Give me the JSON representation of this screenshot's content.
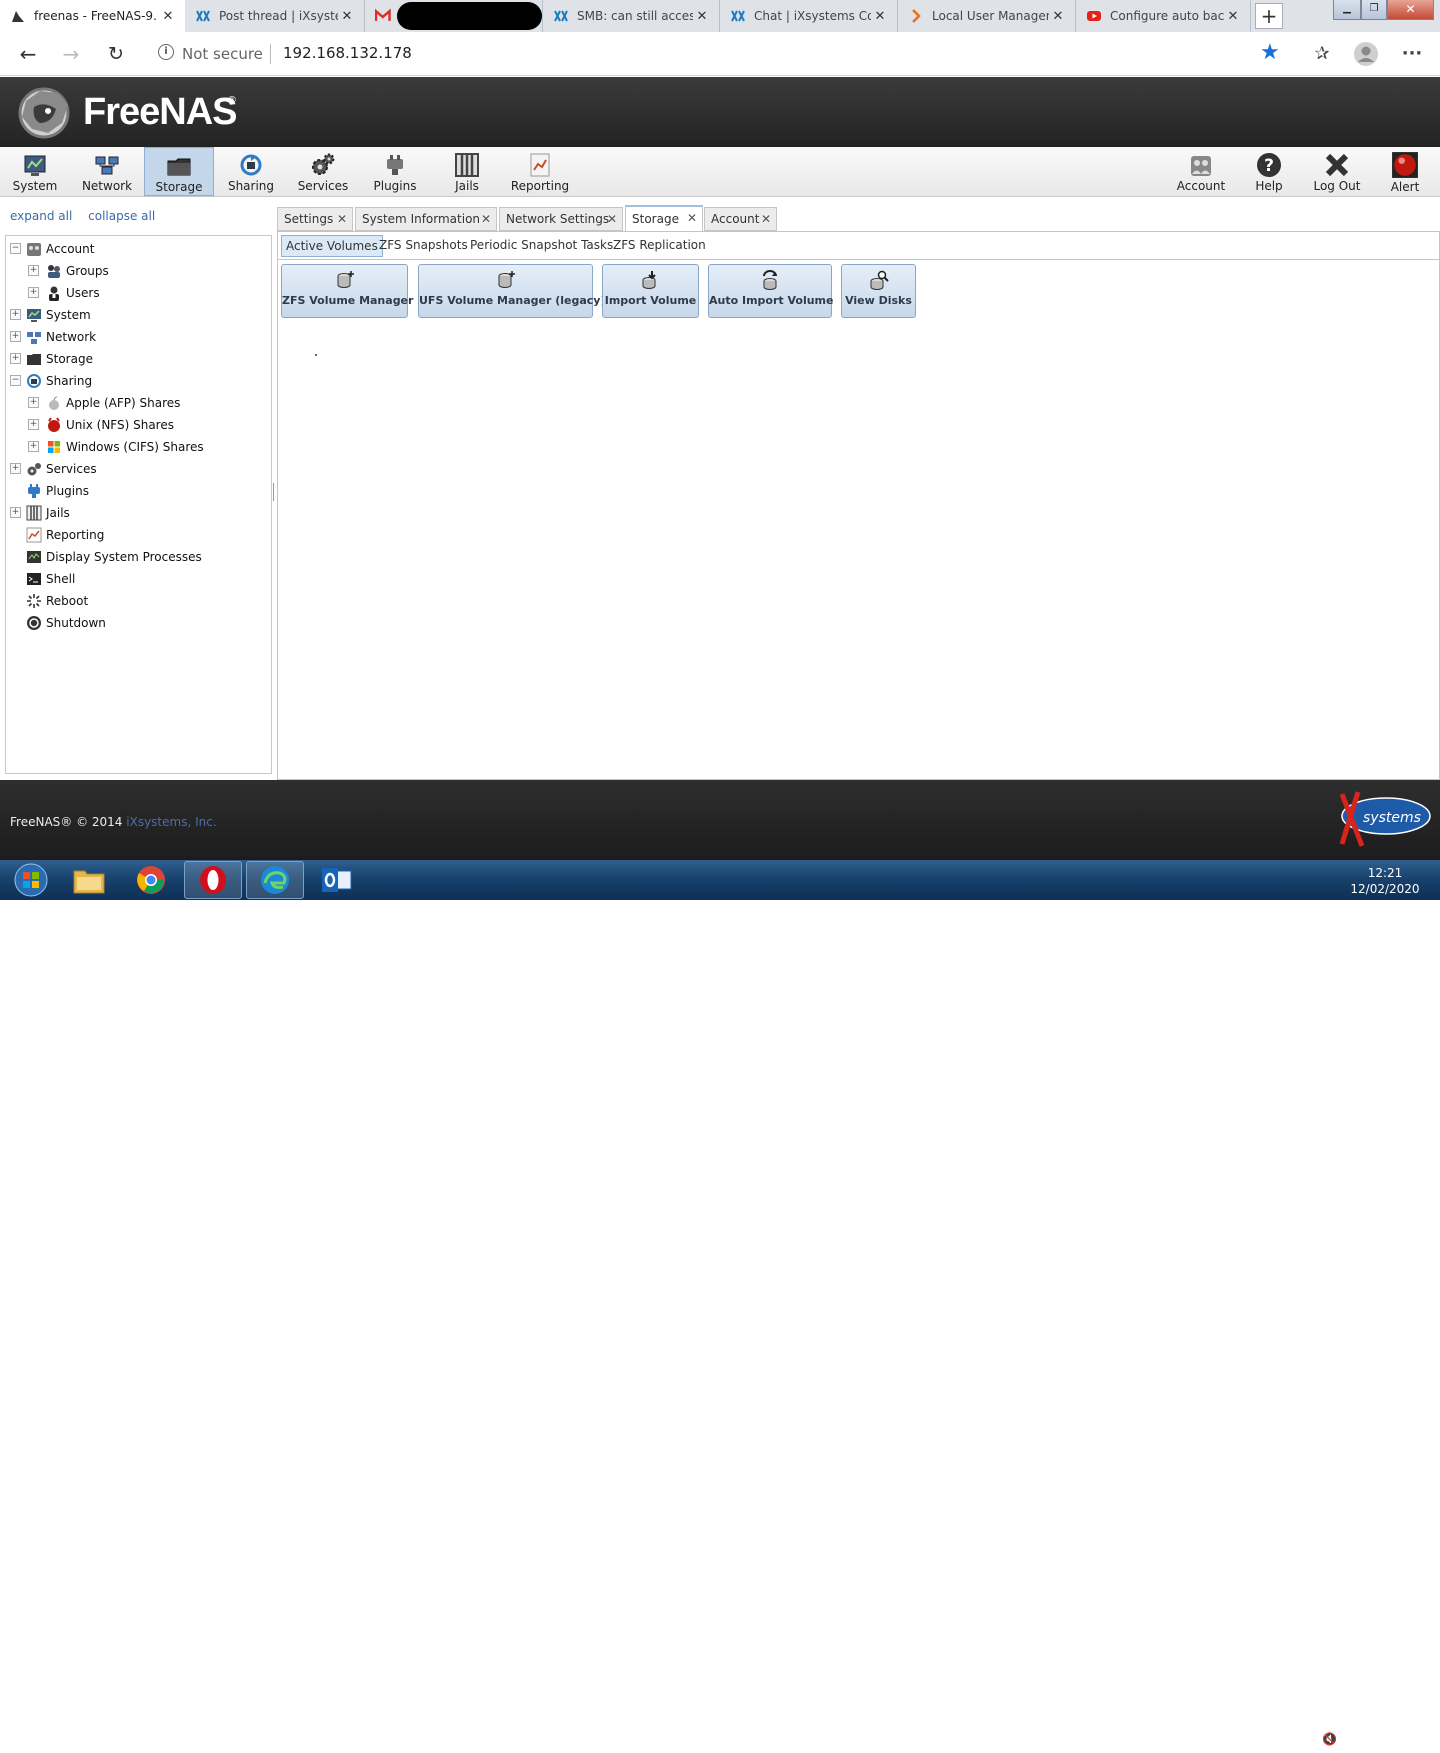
{
  "browser": {
    "tabs": [
      {
        "title": "freenas - FreeNAS-9.",
        "icon": "freenas-icon",
        "active": true
      },
      {
        "title": "Post thread | iXsystem",
        "icon": "ixsystems-icon",
        "active": false
      },
      {
        "title": "",
        "icon": "gmail-icon",
        "active": false
      },
      {
        "title": "SMB: can still access",
        "icon": "ixsystems-icon",
        "active": false
      },
      {
        "title": "Chat | iXsystems Com",
        "icon": "ixsystems-icon",
        "active": false
      },
      {
        "title": "Local User Managem",
        "icon": "arrow-icon",
        "active": false
      },
      {
        "title": "Configure auto back",
        "icon": "youtube-icon",
        "active": false
      }
    ],
    "new_tab_label": "+",
    "address": {
      "security": "Not secure",
      "url": "192.168.132.178"
    },
    "close_glyph": "✕"
  },
  "freenas": {
    "logo_text": "FreeNAS",
    "logo_reg": "®",
    "toolbar_left": [
      {
        "label": "System",
        "icon": "system-icon"
      },
      {
        "label": "Network",
        "icon": "network-icon"
      },
      {
        "label": "Storage",
        "icon": "storage-icon",
        "selected": true
      },
      {
        "label": "Sharing",
        "icon": "sharing-icon"
      },
      {
        "label": "Services",
        "icon": "services-icon"
      },
      {
        "label": "Plugins",
        "icon": "plugins-icon"
      },
      {
        "label": "Jails",
        "icon": "jails-icon"
      },
      {
        "label": "Reporting",
        "icon": "reporting-icon"
      }
    ],
    "toolbar_right": [
      {
        "label": "Account",
        "icon": "account-icon"
      },
      {
        "label": "Help",
        "icon": "help-icon"
      },
      {
        "label": "Log Out",
        "icon": "logout-icon"
      },
      {
        "label": "Alert",
        "icon": "alert-icon"
      }
    ]
  },
  "tree": {
    "expand_all": "expand all",
    "collapse_all": "collapse all",
    "nodes": [
      {
        "label": "Account",
        "level": 0,
        "expander": "−",
        "icon": "account-icon"
      },
      {
        "label": "Groups",
        "level": 1,
        "expander": "+",
        "icon": "groups-icon"
      },
      {
        "label": "Users",
        "level": 1,
        "expander": "+",
        "icon": "users-icon"
      },
      {
        "label": "System",
        "level": 0,
        "expander": "+",
        "icon": "system-icon"
      },
      {
        "label": "Network",
        "level": 0,
        "expander": "+",
        "icon": "network-icon"
      },
      {
        "label": "Storage",
        "level": 0,
        "expander": "+",
        "icon": "storage-icon"
      },
      {
        "label": "Sharing",
        "level": 0,
        "expander": "−",
        "icon": "sharing-icon"
      },
      {
        "label": "Apple (AFP) Shares",
        "level": 1,
        "expander": "+",
        "icon": "apple-icon"
      },
      {
        "label": "Unix (NFS) Shares",
        "level": 1,
        "expander": "+",
        "icon": "unix-icon"
      },
      {
        "label": "Windows (CIFS) Shares",
        "level": 1,
        "expander": "+",
        "icon": "windows-icon"
      },
      {
        "label": "Services",
        "level": 0,
        "expander": "+",
        "icon": "services-icon"
      },
      {
        "label": "Plugins",
        "level": 0,
        "expander": "",
        "icon": "plugins-icon"
      },
      {
        "label": "Jails",
        "level": 0,
        "expander": "+",
        "icon": "jails-icon"
      },
      {
        "label": "Reporting",
        "level": 0,
        "expander": "",
        "icon": "reporting-icon"
      },
      {
        "label": "Display System Processes",
        "level": 0,
        "expander": "",
        "icon": "processes-icon"
      },
      {
        "label": "Shell",
        "level": 0,
        "expander": "",
        "icon": "shell-icon"
      },
      {
        "label": "Reboot",
        "level": 0,
        "expander": "",
        "icon": "reboot-icon"
      },
      {
        "label": "Shutdown",
        "level": 0,
        "expander": "",
        "icon": "shutdown-icon"
      }
    ]
  },
  "content": {
    "tabs": [
      {
        "label": "Settings",
        "active": false
      },
      {
        "label": "System Information",
        "active": false
      },
      {
        "label": "Network Settings",
        "active": false
      },
      {
        "label": "Storage",
        "active": true
      },
      {
        "label": "Account",
        "active": false
      }
    ],
    "tab_close": "✕",
    "subtabs": [
      {
        "label": "Active Volumes",
        "active": true
      },
      {
        "label": "ZFS Snapshots",
        "active": false
      },
      {
        "label": "Periodic Snapshot Tasks",
        "active": false
      },
      {
        "label": "ZFS Replication",
        "active": false
      }
    ],
    "actions": [
      {
        "label": "ZFS Volume Manager",
        "icon": "volume-add-icon"
      },
      {
        "label": "UFS Volume Manager (legacy)",
        "icon": "volume-add-icon"
      },
      {
        "label": "Import Volume",
        "icon": "import-icon"
      },
      {
        "label": "Auto Import Volume",
        "icon": "auto-import-icon"
      },
      {
        "label": "View Disks",
        "icon": "view-disks-icon"
      }
    ]
  },
  "footer": {
    "copyright": "FreeNAS® © 2014",
    "company": "iXsystems, Inc.",
    "ix_logo_text": "systems"
  },
  "taskbar": {
    "time": "12:21",
    "date": "12/02/2020"
  }
}
